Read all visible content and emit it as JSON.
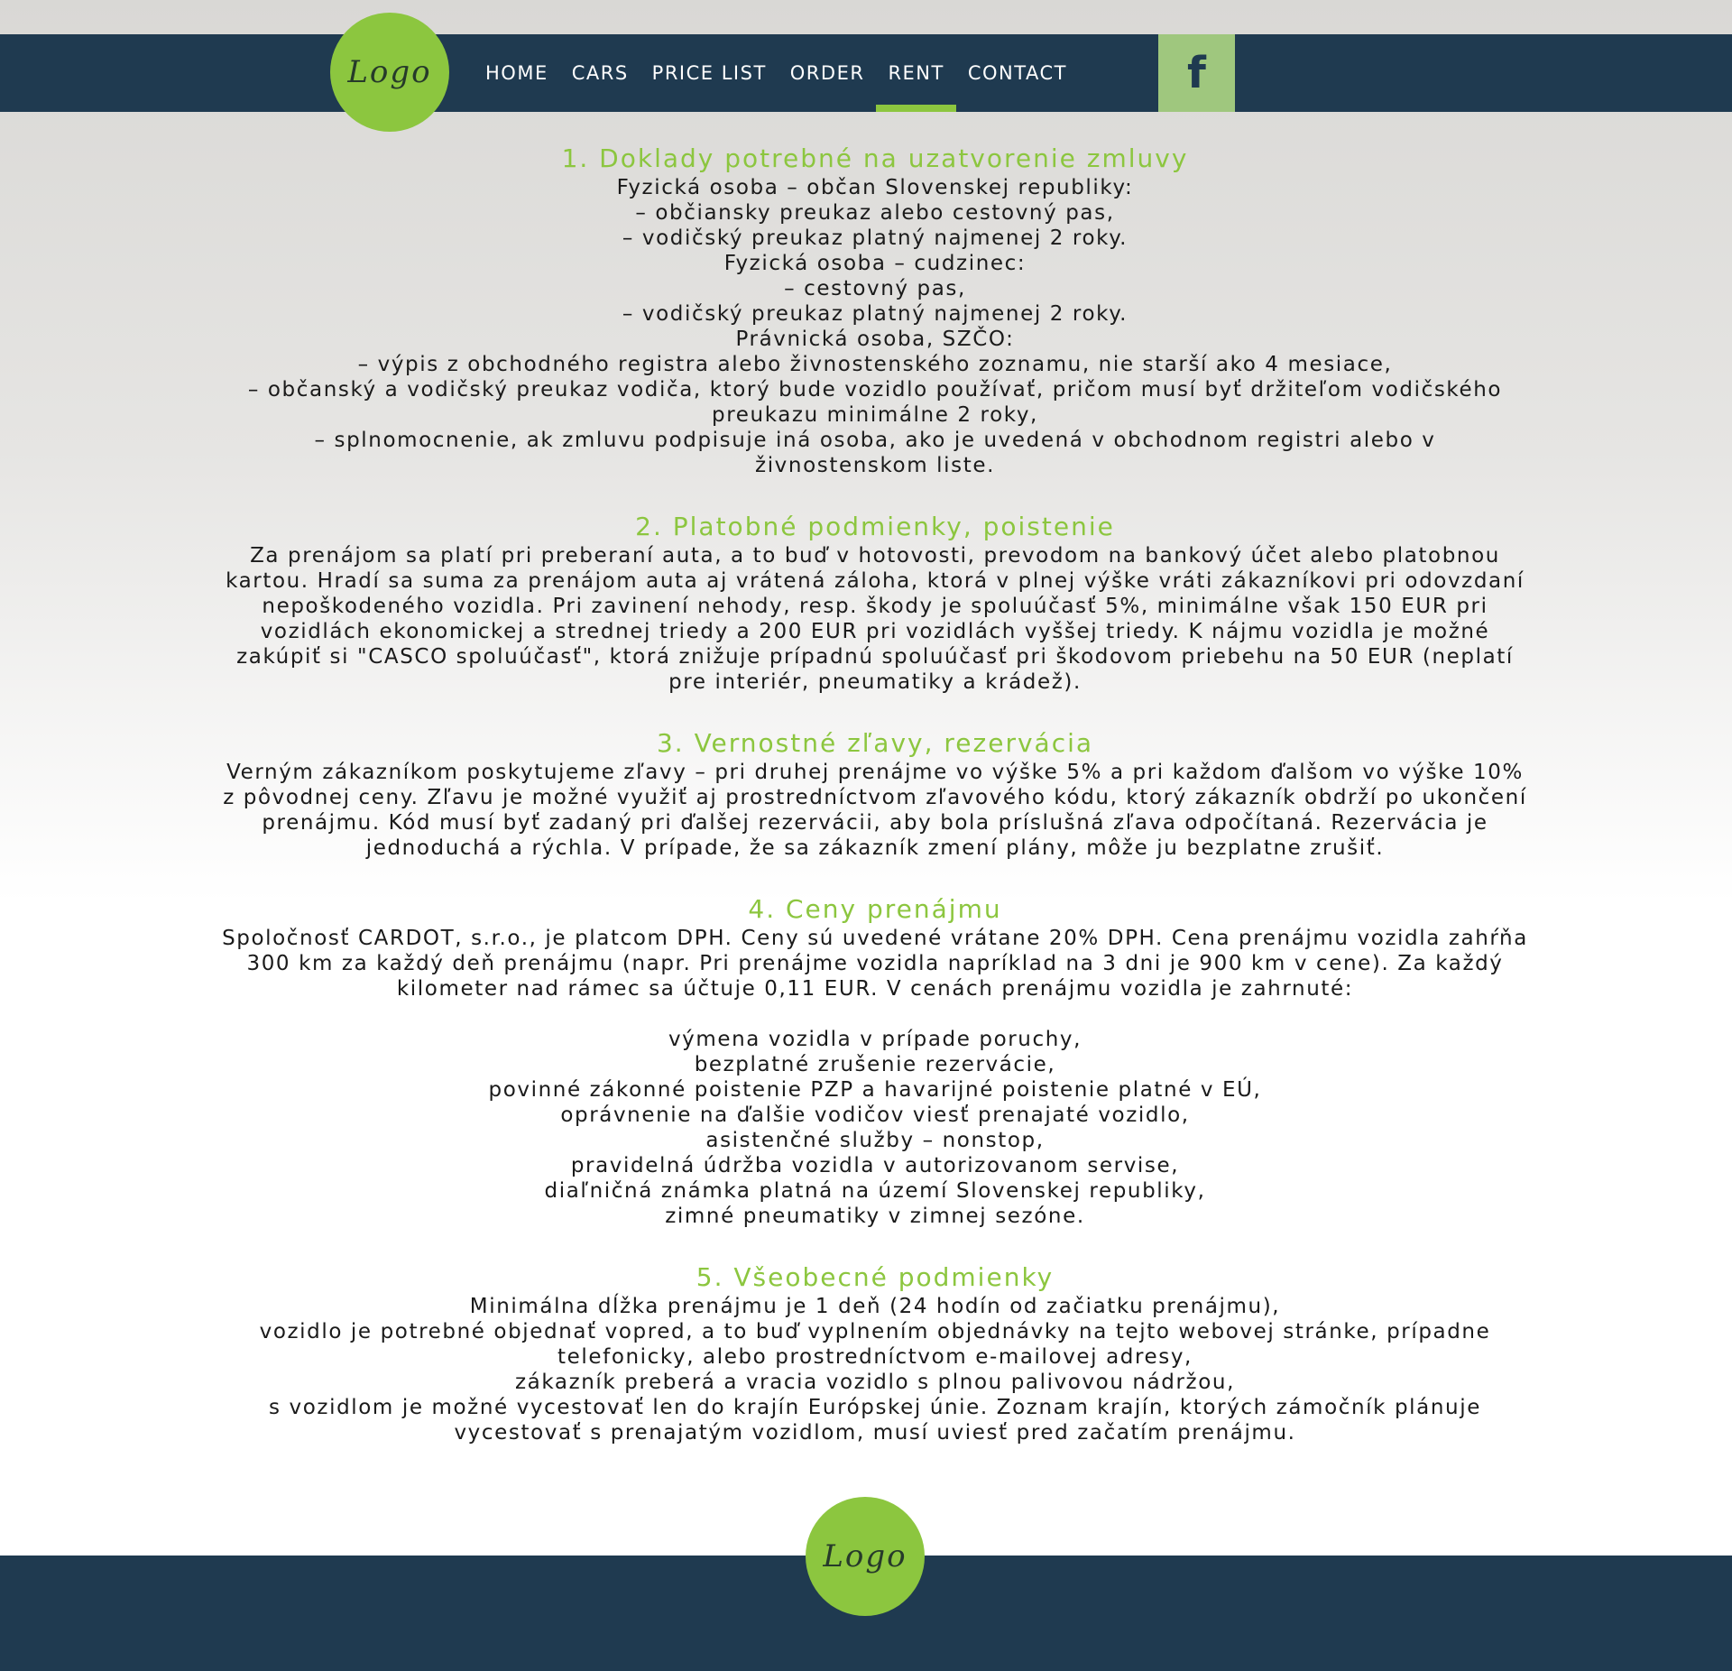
{
  "header": {
    "logo_text": "Logo",
    "nav": [
      "HOME",
      "CARS",
      "PRICE LIST",
      "ORDER",
      "RENT",
      "CONTACT"
    ],
    "active_nav": "RENT",
    "facebook_label": "f"
  },
  "sections": [
    {
      "title": "1. Doklady potrebné na uzatvorenie zmluvy",
      "lines": [
        "Fyzická osoba – občan Slovenskej republiky:",
        "– občiansky preukaz alebo cestovný pas,",
        "– vodičský preukaz platný najmenej 2 roky.",
        "Fyzická osoba – cudzinec:",
        "– cestovný pas,",
        "– vodičský preukaz platný najmenej 2 roky.",
        "Právnická osoba, SZČO:",
        "– výpis z obchodného registra alebo živnostenského zoznamu, nie starší ako 4 mesiace,",
        "– občanský a vodičský preukaz vodiča, ktorý bude vozidlo používať, pričom musí byť držiteľom vodičského",
        "preukazu minimálne 2 roky,",
        "– splnomocnenie, ak zmluvu podpisuje iná osoba, ako je uvedená v obchodnom registri alebo v",
        "živnostenskom liste."
      ]
    },
    {
      "title": "2. Platobné podmienky, poistenie",
      "lines": [
        "Za prenájom sa platí pri preberaní auta, a to buď v hotovosti, prevodom na bankový účet alebo platobnou",
        "kartou. Hradí sa suma za prenájom auta aj vrátená záloha, ktorá v plnej výške vráti zákazníkovi pri odovzdaní",
        "nepoškodeného vozidla. Pri zavinení nehody, resp. škody je spoluúčasť 5%, minimálne však 150 EUR pri",
        "vozidlách ekonomickej a strednej triedy a 200 EUR pri vozidlách vyššej triedy. K nájmu vozidla je možné",
        "zakúpiť si \"CASCO spoluúčasť\", ktorá znižuje prípadnú spoluúčasť pri škodovom priebehu na 50 EUR (neplatí",
        "pre interiér, pneumatiky a krádež)."
      ]
    },
    {
      "title": "3. Vernostné zľavy, rezervácia",
      "lines": [
        "Verným zákazníkom poskytujeme zľavy – pri druhej prenájme vo výške 5% a pri každom ďalšom vo výške 10%",
        "z pôvodnej ceny. Zľavu je možné využiť aj prostredníctvom zľavového kódu, ktorý zákazník obdrží po ukončení",
        "prenájmu. Kód musí byť zadaný pri ďalšej rezervácii, aby bola príslušná zľava odpočítaná. Rezervácia je",
        "jednoduchá a rýchla. V prípade, že sa zákazník zmení plány, môže ju bezplatne zrušiť."
      ]
    },
    {
      "title": "4. Ceny prenájmu",
      "lines": [
        "Spoločnosť CARDOT, s.r.o., je platcom DPH. Ceny sú uvedené vrátane 20% DPH. Cena prenájmu vozidla zahŕňa",
        "300 km za každý deň prenájmu (napr. Pri prenájme vozidla napríklad na 3 dni je 900 km v cene). Za každý",
        "kilometer nad rámec sa účtuje 0,11 EUR. V cenách prenájmu vozidla je zahrnuté:",
        "",
        "výmena vozidla v prípade poruchy,",
        "bezplatné zrušenie rezervácie,",
        "povinné zákonné poistenie PZP a havarijné poistenie platné v EÚ,",
        "oprávnenie na ďalšie vodičov viesť prenajaté vozidlo,",
        "asistenčné služby – nonstop,",
        "pravidelná údržba vozidla v autorizovanom servise,",
        "diaľničná známka platná na území Slovenskej republiky,",
        "zimné pneumatiky v zimnej sezóne."
      ]
    },
    {
      "title": "5. Všeobecné podmienky",
      "lines": [
        "Minimálna dĺžka prenájmu je 1 deň (24 hodín od začiatku prenájmu),",
        "vozidlo je potrebné objednať vopred, a to buď vyplnením objednávky na tejto webovej stránke, prípadne",
        "telefonicky, alebo prostredníctvom e-mailovej adresy,",
        "zákazník preberá a vracia vozidlo s plnou palivovou nádržou,",
        "s vozidlom je možné vycestovať len do krajín Európskej únie. Zoznam krajín, ktorých zámočník plánuje",
        "vycestovať s prenajatým vozidlom, musí uviesť pred začatím prenájmu."
      ]
    }
  ],
  "footer": {
    "logo_text": "Logo"
  },
  "colors": {
    "navy": "#1f3a50",
    "green": "#8cc63f",
    "facebook_bg": "#9fc77e"
  }
}
